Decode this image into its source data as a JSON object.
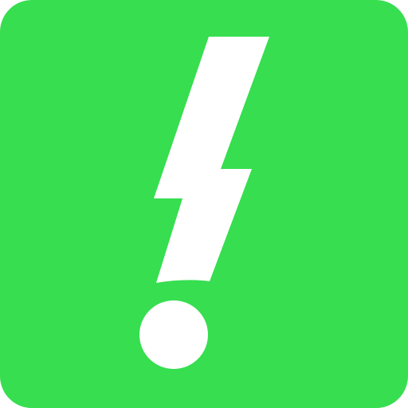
{
  "icon": {
    "name": "lightning-exclamation-icon",
    "background_color": "#36DE50",
    "foreground_color": "#FFFFFF"
  }
}
